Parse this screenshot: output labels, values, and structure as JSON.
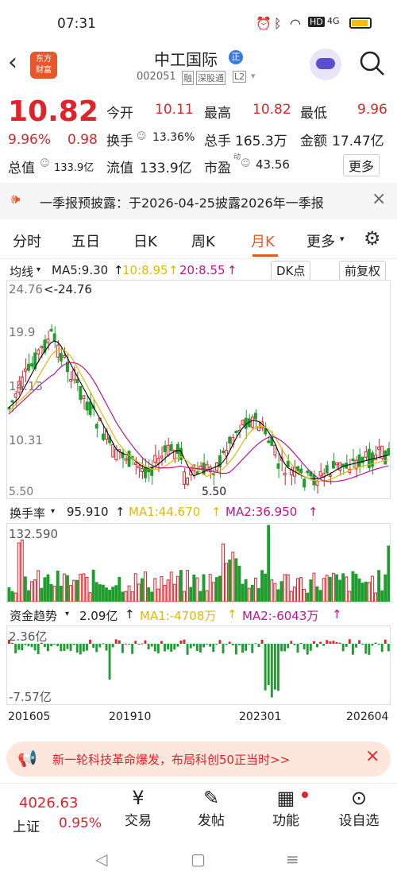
{
  "status": {
    "time": "07:31",
    "battery": "HD",
    "net": "4G"
  },
  "header": {
    "logo_line1": "东方",
    "logo_line2": "财富",
    "stock_name": "中工国际",
    "badge": "正",
    "code": "002051",
    "tag1": "融",
    "tag2": "深股通",
    "tag3": "L2"
  },
  "quote": {
    "price": "10.82",
    "pct": "9.96%",
    "chg": "0.98",
    "open_label": "今开",
    "open": "10.11",
    "high_label": "最高",
    "high": "10.82",
    "low_label": "最低",
    "low": "9.96",
    "turnover_label": "换手",
    "turnover": "13.36%",
    "volume_label": "总手",
    "volume": "165.3万",
    "amount_label": "金额",
    "amount": "17.47亿",
    "mcap_label": "总值",
    "mcap": "133.9亿",
    "float_label": "流值",
    "float": "133.9亿",
    "pe_label": "市盈",
    "pe_sup": "动",
    "pe": "43.56",
    "more": "更多"
  },
  "notice": {
    "text": "一季报预披露：于2026-04-25披露2026年一季报"
  },
  "tabs": [
    "分时",
    "五日",
    "日K",
    "周K",
    "月K",
    "更多"
  ],
  "active_tab": "月K",
  "kline": {
    "indicator": "均线",
    "ma5": "MA5:9.30",
    "ma10": "10:8.95",
    "ma20": "20:8.55",
    "dk": "DK点",
    "fq": "前复权",
    "price_top": "24.76",
    "price_mid1": "19.9",
    "price_mid2": "14.13",
    "price_mid3": "10.31",
    "price_low": "5.50",
    "max_label": "<-24.76",
    "min_label": "5.50"
  },
  "turnover_panel": {
    "label": "换手率",
    "value": "95.910",
    "ma1": "MA1:44.670",
    "ma2": "MA2:36.950",
    "top": "132.590"
  },
  "fund_panel": {
    "label": "资金趋势",
    "value": "2.09亿",
    "ma1": "MA1:-4708万",
    "ma2": "MA2:-6043万",
    "top": "2.36亿",
    "bottom": "-7.57亿"
  },
  "xaxis": [
    "201605",
    "201910",
    "202301",
    "202604"
  ],
  "colors": {
    "up": "#e0222b",
    "down": "#1f9d2e",
    "ma5": "#111111",
    "ma10": "#e6b800",
    "ma20": "#c0148c"
  },
  "promo": {
    "text": "新一轮科技革命爆发，布局科创50正当时>>"
  },
  "bottom": {
    "index_value": "4026.63",
    "index_name": "上证",
    "index_pct": "0.95%",
    "trade": "交易",
    "post": "发帖",
    "func": "功能",
    "watch": "设自选"
  }
}
